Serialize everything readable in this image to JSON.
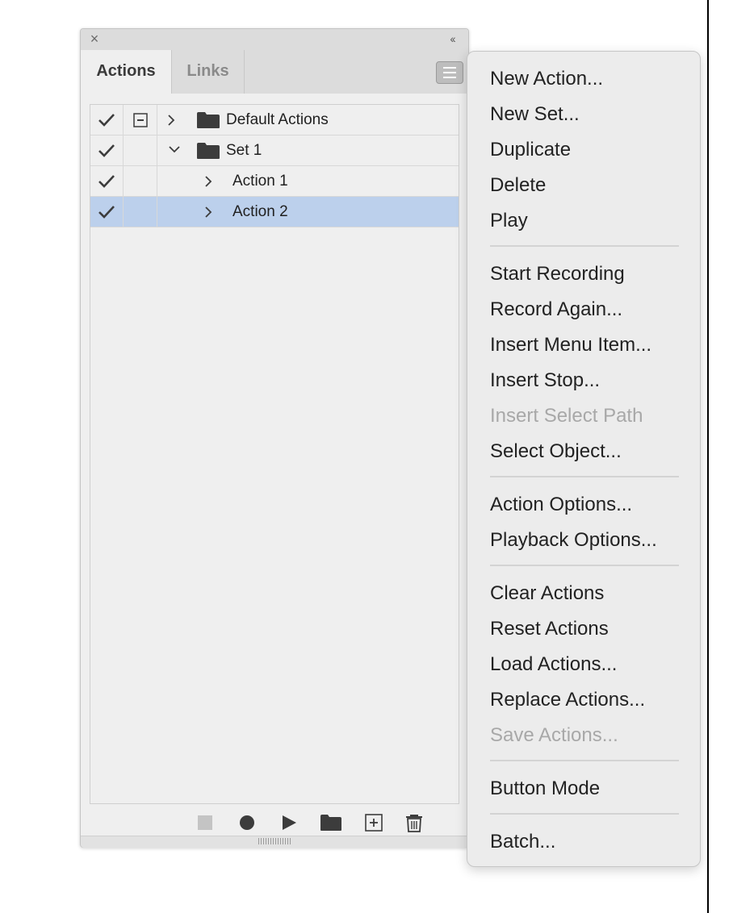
{
  "colors": {
    "selected_row": "#bcd0ec",
    "disabled_text": "#a8a8a8",
    "icon": "#3c3c3c"
  },
  "panel": {
    "close_icon": "close-icon",
    "collapse_label": "‹‹",
    "tabs": [
      {
        "label": "Actions",
        "active": true
      },
      {
        "label": "Links",
        "active": false
      }
    ],
    "menu_icon": "hamburger-icon",
    "rows": [
      {
        "label": "Default Actions",
        "checked": true,
        "dialog": true,
        "expanded": false,
        "type": "set",
        "selected": false
      },
      {
        "label": "Set 1",
        "checked": true,
        "dialog": false,
        "expanded": true,
        "type": "set",
        "selected": false
      },
      {
        "label": "Action 1",
        "checked": true,
        "dialog": false,
        "expanded": false,
        "type": "action",
        "selected": false
      },
      {
        "label": "Action 2",
        "checked": true,
        "dialog": false,
        "expanded": false,
        "type": "action",
        "selected": true
      }
    ],
    "toolbar": [
      {
        "icon": "stop-icon",
        "enabled": false
      },
      {
        "icon": "record-icon",
        "enabled": true
      },
      {
        "icon": "play-icon",
        "enabled": true
      },
      {
        "icon": "new-set-folder-icon",
        "enabled": true
      },
      {
        "icon": "new-action-icon",
        "enabled": true
      },
      {
        "icon": "trash-icon",
        "enabled": true
      }
    ]
  },
  "menu": {
    "items": [
      {
        "label": "New Action...",
        "enabled": true
      },
      {
        "label": "New Set...",
        "enabled": true
      },
      {
        "label": "Duplicate",
        "enabled": true
      },
      {
        "label": "Delete",
        "enabled": true
      },
      {
        "label": "Play",
        "enabled": true
      },
      {
        "separator": true
      },
      {
        "label": "Start Recording",
        "enabled": true
      },
      {
        "label": "Record Again...",
        "enabled": true
      },
      {
        "label": "Insert Menu Item...",
        "enabled": true
      },
      {
        "label": "Insert Stop...",
        "enabled": true
      },
      {
        "label": "Insert Select Path",
        "enabled": false
      },
      {
        "label": "Select Object...",
        "enabled": true
      },
      {
        "separator": true
      },
      {
        "label": "Action Options...",
        "enabled": true
      },
      {
        "label": "Playback Options...",
        "enabled": true
      },
      {
        "separator": true
      },
      {
        "label": "Clear Actions",
        "enabled": true
      },
      {
        "label": "Reset Actions",
        "enabled": true
      },
      {
        "label": "Load Actions...",
        "enabled": true
      },
      {
        "label": "Replace Actions...",
        "enabled": true
      },
      {
        "label": "Save Actions...",
        "enabled": false
      },
      {
        "separator": true
      },
      {
        "label": "Button Mode",
        "enabled": true
      },
      {
        "separator": true
      },
      {
        "label": "Batch...",
        "enabled": true
      }
    ]
  }
}
